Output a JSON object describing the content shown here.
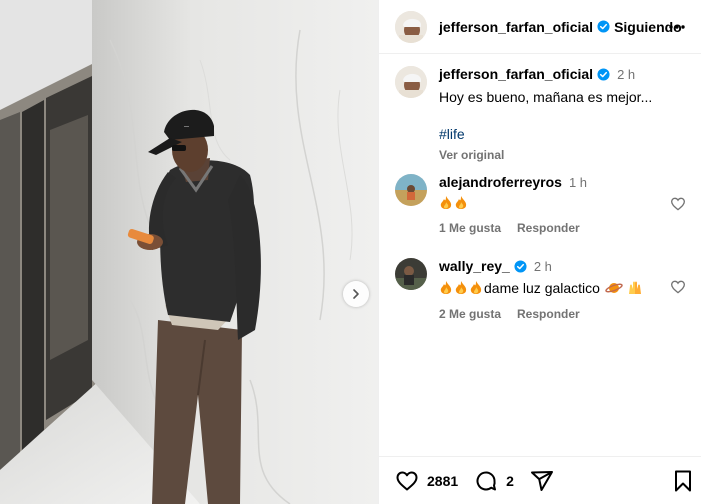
{
  "post": {
    "author": "jefferson_farfan_oficial",
    "follow_status": "Siguiendo",
    "caption": {
      "username": "jefferson_farfan_oficial",
      "time": "2 h",
      "text": "Hoy es bueno, mañana es mejor...",
      "hashtag": "#life",
      "see_original": "Ver original"
    }
  },
  "comments": [
    {
      "username": "alejandroferreyros",
      "time": "1 h",
      "emojis": [
        "fire-emoji",
        "fire-emoji"
      ],
      "text": "",
      "likes": "1 Me gusta",
      "reply": "Responder",
      "verified": false
    },
    {
      "username": "wally_rey_",
      "time": "2 h",
      "emojis": [
        "fire-emoji",
        "fire-emoji",
        "fire-emoji"
      ],
      "text": "dame luz galactico",
      "trailing_emojis": [
        "planet-emoji",
        "raising-hands-emoji"
      ],
      "likes": "2 Me gusta",
      "reply": "Responder",
      "verified": true
    }
  ],
  "actions": {
    "likes_count": "2881",
    "comments_count": "2"
  },
  "colors": {
    "verified": "#0095f6",
    "secondary_text": "#737373",
    "hashtag": "#00376b",
    "divider": "#efefef"
  },
  "icons": [
    "more-icon",
    "heart-icon",
    "comment-icon",
    "share-icon",
    "save-icon",
    "chevron-right-icon",
    "verified-badge-icon"
  ]
}
